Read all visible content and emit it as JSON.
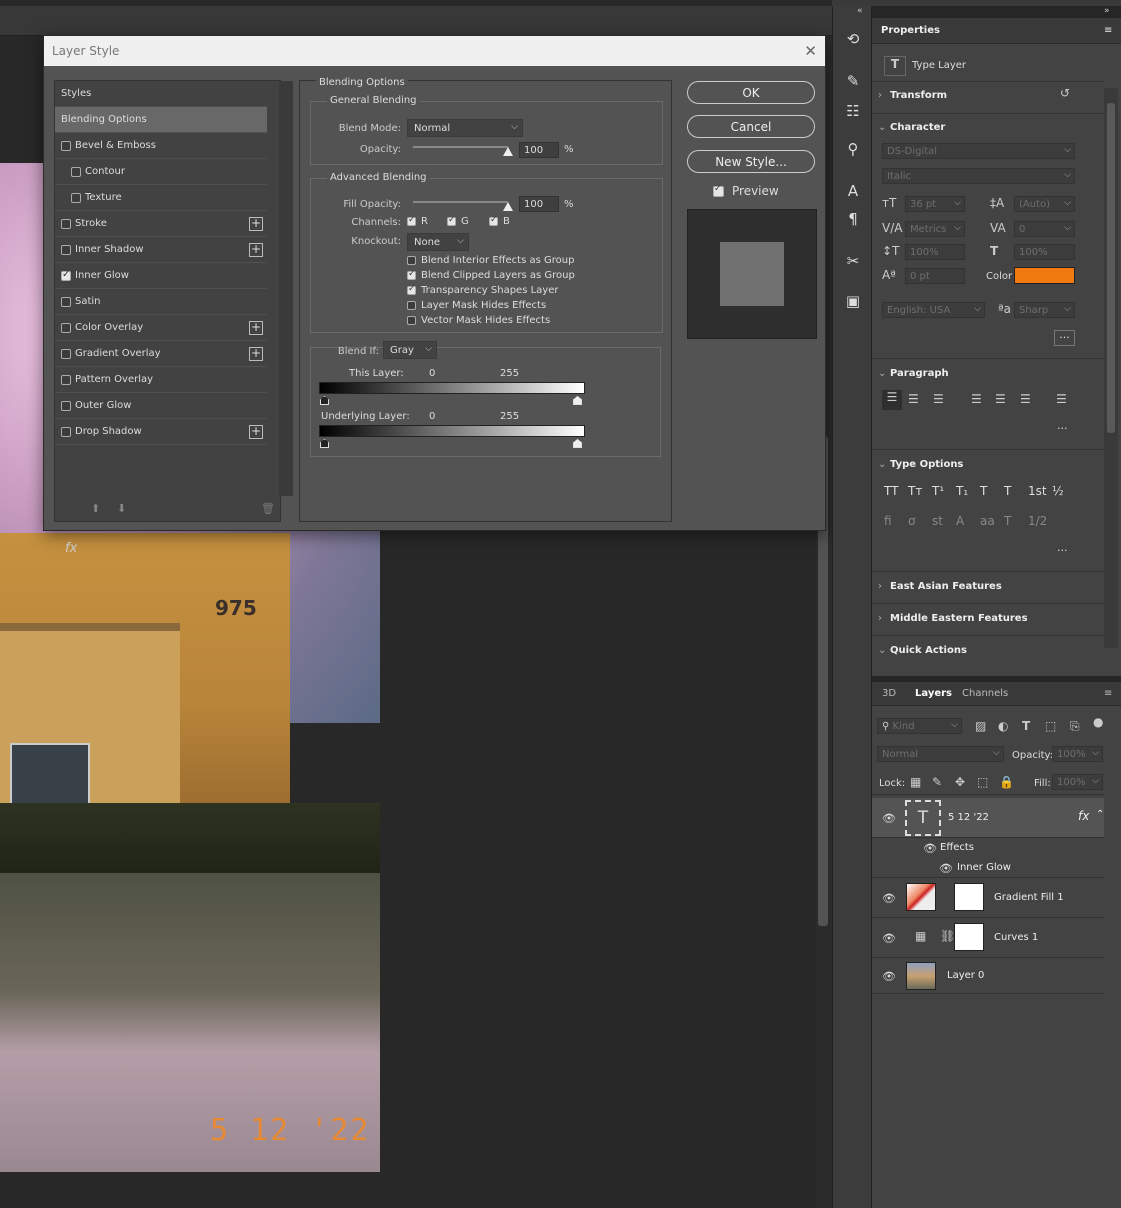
{
  "dialog": {
    "title": "Layer Style",
    "close": "✕",
    "styles_header": "Styles",
    "styles": [
      {
        "label": "Blending Options",
        "checkbox": false,
        "checked": false,
        "plus": false,
        "selected": true,
        "indent": false
      },
      {
        "label": "Bevel & Emboss",
        "checkbox": true,
        "checked": false,
        "plus": false,
        "selected": false,
        "indent": false
      },
      {
        "label": "Contour",
        "checkbox": true,
        "checked": false,
        "plus": false,
        "selected": false,
        "indent": true
      },
      {
        "label": "Texture",
        "checkbox": true,
        "checked": false,
        "plus": false,
        "selected": false,
        "indent": true
      },
      {
        "label": "Stroke",
        "checkbox": true,
        "checked": false,
        "plus": true,
        "selected": false,
        "indent": false
      },
      {
        "label": "Inner Shadow",
        "checkbox": true,
        "checked": false,
        "plus": true,
        "selected": false,
        "indent": false
      },
      {
        "label": "Inner Glow",
        "checkbox": true,
        "checked": true,
        "plus": false,
        "selected": false,
        "indent": false
      },
      {
        "label": "Satin",
        "checkbox": true,
        "checked": false,
        "plus": false,
        "selected": false,
        "indent": false
      },
      {
        "label": "Color Overlay",
        "checkbox": true,
        "checked": false,
        "plus": true,
        "selected": false,
        "indent": false
      },
      {
        "label": "Gradient Overlay",
        "checkbox": true,
        "checked": false,
        "plus": true,
        "selected": false,
        "indent": false
      },
      {
        "label": "Pattern Overlay",
        "checkbox": true,
        "checked": false,
        "plus": false,
        "selected": false,
        "indent": false
      },
      {
        "label": "Outer Glow",
        "checkbox": true,
        "checked": false,
        "plus": false,
        "selected": false,
        "indent": false
      },
      {
        "label": "Drop Shadow",
        "checkbox": true,
        "checked": false,
        "plus": true,
        "selected": false,
        "indent": false
      }
    ],
    "footer_fx": "fx",
    "blending": {
      "section": "Blending Options",
      "general": "General Blending",
      "blend_mode_label": "Blend Mode:",
      "blend_mode": "Normal",
      "opacity_label": "Opacity:",
      "opacity": "100",
      "opacity_fraction": 1.0,
      "percent": "%",
      "advanced": "Advanced Blending",
      "fill_label": "Fill Opacity:",
      "fill": "100",
      "fill_fraction": 1.0,
      "channels_label": "Channels:",
      "channels": [
        "R",
        "G",
        "B"
      ],
      "knockout_label": "Knockout:",
      "knockout": "None",
      "options": [
        {
          "label": "Blend Interior Effects as Group",
          "checked": false
        },
        {
          "label": "Blend Clipped Layers as Group",
          "checked": true
        },
        {
          "label": "Transparency Shapes Layer",
          "checked": true
        },
        {
          "label": "Layer Mask Hides Effects",
          "checked": false
        },
        {
          "label": "Vector Mask Hides Effects",
          "checked": false
        }
      ],
      "blend_if_label": "Blend If:",
      "blend_if": "Gray",
      "this_layer": "This Layer:",
      "underlying": "Underlying Layer:",
      "low": "0",
      "high": "255"
    },
    "buttons": {
      "ok": "OK",
      "cancel": "Cancel",
      "new_style": "New Style...",
      "preview": "Preview"
    }
  },
  "canvas": {
    "building_number": "975",
    "date_stamp": "5 12 '22"
  },
  "properties": {
    "tab": "Properties",
    "layer_type": "Type Layer",
    "transform": "Transform",
    "character": "Character",
    "font": "DS-Digital",
    "style": "Italic",
    "size": "36 pt",
    "leading": "(Auto)",
    "kerning": "Metrics",
    "tracking": "0",
    "vscale": "100%",
    "hscale": "100%",
    "baseline": "0 pt",
    "color_label": "Color",
    "color": "#f07a10",
    "language": "English: USA",
    "aa_icon": "ªa",
    "antialias": "Sharp",
    "paragraph": "Paragraph",
    "type_options": "Type Options",
    "type_glyphs": [
      "TT",
      "Tт",
      "T¹",
      "T₁",
      "T",
      "T",
      "1st",
      "½"
    ],
    "type_glyphs2": [
      "ﬁ",
      "ơ",
      "st",
      "A",
      "aa",
      "T",
      "1/2"
    ],
    "east_asian": "East Asian Features",
    "middle_eastern": "Middle Eastern Features",
    "quick_actions": "Quick Actions"
  },
  "layers": {
    "tabs": [
      "3D",
      "Layers",
      "Channels"
    ],
    "kind": "Kind",
    "blend": "Normal",
    "opacity_label": "Opacity:",
    "opacity": "100%",
    "lock_label": "Lock:",
    "fill_label": "Fill:",
    "fill": "100%",
    "items": [
      {
        "name": "5 12 '22",
        "type": "type"
      },
      {
        "name": "Gradient Fill 1",
        "type": "gradient"
      },
      {
        "name": "Curves 1",
        "type": "curves"
      },
      {
        "name": "Layer 0",
        "type": "image"
      }
    ],
    "effects": "Effects",
    "effect_item": "Inner Glow",
    "fx": "fx"
  }
}
